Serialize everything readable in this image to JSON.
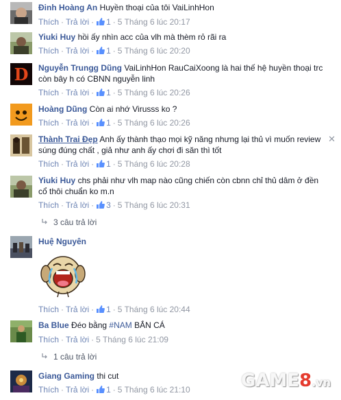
{
  "like_label": "Thích",
  "reply_label": "Trả lời",
  "close_glyph": "✕",
  "comments": [
    {
      "author": "Đinh Hoàng An",
      "text": "Huyền thoại của tôi VaiLinhHon",
      "likes": "1",
      "time": "5 Tháng 6 lúc 20:17"
    },
    {
      "author": "Yiuki Huy",
      "text": "hồi ấy nhìn acc của vlh mà thèm rỏ rãi ra",
      "likes": "1",
      "time": "5 Tháng 6 lúc 20:20"
    },
    {
      "author": "Nguyễn Trungg Dũng",
      "text": "VaiLinhHon RauCaiXoong là hai thế hệ huyền thoại trc còn bây h có CBNN nguyễn linh",
      "likes": "1",
      "time": "5 Tháng 6 lúc 20:26"
    },
    {
      "author": "Hoàng Dũng",
      "text": "Còn ai nhớ Virusss ko ?",
      "likes": "1",
      "time": "5 Tháng 6 lúc 20:26"
    },
    {
      "author": "Thành Trai Đẹp",
      "text": "Anh ấy thành thạo mọi kỹ năng nhưng lại thủ vì muốn review súng đúng chất , giả như anh ấy chơi đi săn thì tốt",
      "likes": "1",
      "time": "5 Tháng 6 lúc 20:28"
    },
    {
      "author": "Yiuki Huy",
      "text": "chs phải như vlh map nào cũng chiến còn cbnn chỉ thủ dâm ở đền cổ thôi chuẩn ko m.n",
      "likes": "3",
      "time": "5 Tháng 6 lúc 20:31"
    },
    {
      "author": "Huệ Nguyên",
      "text": "",
      "likes": "1",
      "time": "5 Tháng 6 lúc 20:44"
    },
    {
      "author": "Ba Blue",
      "text_before": "Đéo bằng ",
      "hashtag": "#NAM",
      "text_after": " BẮN CÁ",
      "time": "5 Tháng 6 lúc 21:09"
    },
    {
      "author": "Giang Gaming",
      "text": "thi cut",
      "likes": "1",
      "time": "5 Tháng 6 lúc 21:10"
    }
  ],
  "replies": [
    {
      "label": "3 câu trả lời"
    },
    {
      "label": "1 câu trả lời"
    }
  ],
  "watermark": {
    "part1": "GAME",
    "part2": "8",
    "part3": ".vn"
  },
  "colors": {
    "link": "#3b5998",
    "meta": "#9197a3",
    "action": "#6d84b4"
  }
}
